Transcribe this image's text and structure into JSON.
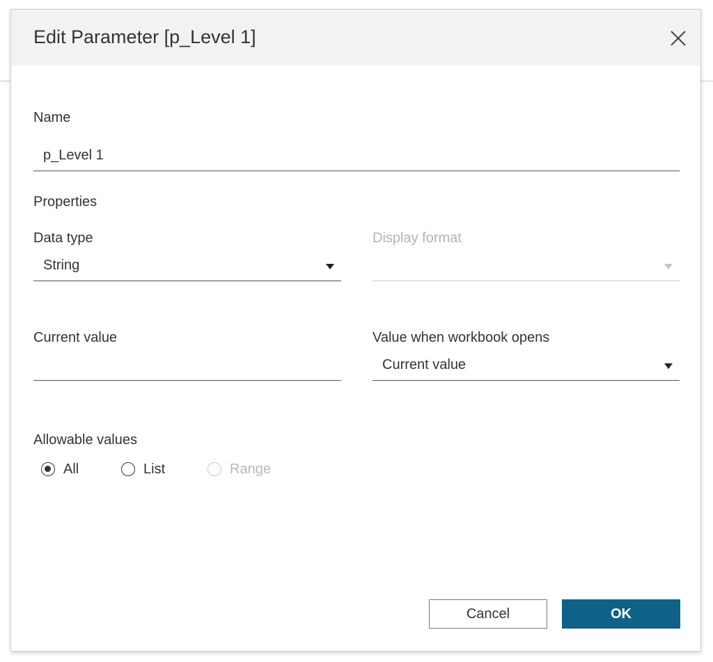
{
  "dialog": {
    "title": "Edit Parameter [p_Level 1]",
    "close_icon": "close-icon"
  },
  "name_section": {
    "label": "Name",
    "value": "p_Level 1"
  },
  "properties": {
    "heading": "Properties",
    "data_type": {
      "label": "Data type",
      "value": "String"
    },
    "display_format": {
      "label": "Display format",
      "value": "",
      "enabled": false
    },
    "current_value": {
      "label": "Current value",
      "value": ""
    },
    "value_when_opens": {
      "label": "Value when workbook opens",
      "value": "Current value"
    }
  },
  "allowable_values": {
    "label": "Allowable values",
    "options": [
      {
        "label": "All",
        "selected": true,
        "enabled": true
      },
      {
        "label": "List",
        "selected": false,
        "enabled": true
      },
      {
        "label": "Range",
        "selected": false,
        "enabled": false
      }
    ]
  },
  "buttons": {
    "cancel_label": "Cancel",
    "ok_label": "OK"
  },
  "colors": {
    "primary_button": "#0f6188",
    "title_bar": "#f2f2f2",
    "disabled_text": "#b3b3b3"
  }
}
